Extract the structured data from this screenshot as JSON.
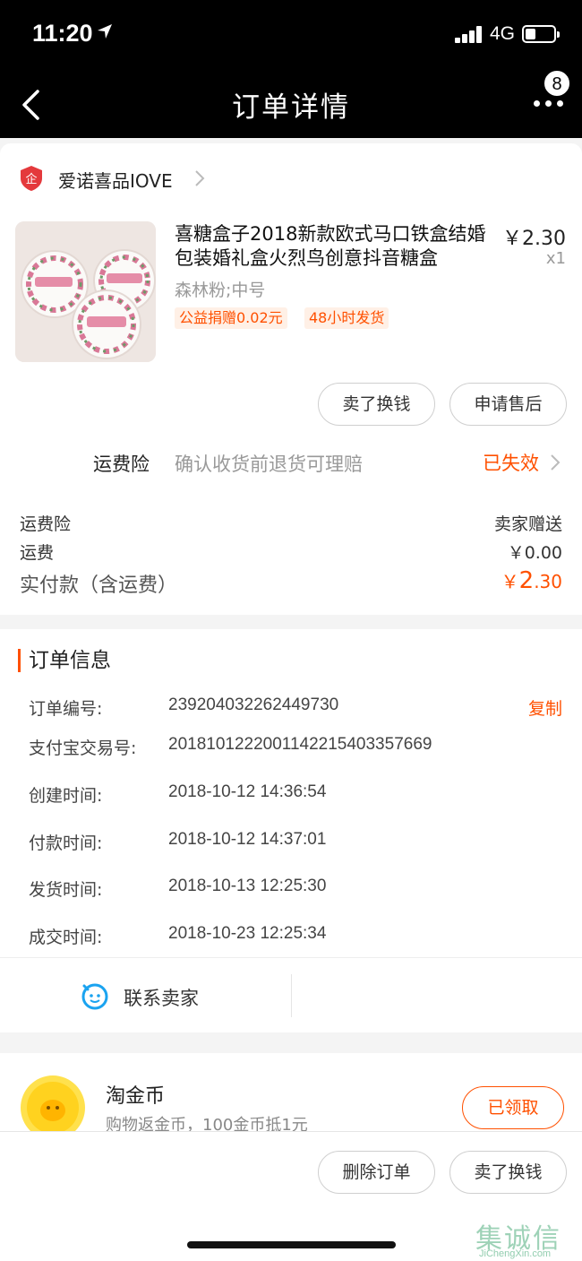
{
  "status_bar": {
    "time": "11:20",
    "network": "4G",
    "battery_level": 0.35
  },
  "nav": {
    "title": "订单详情",
    "badge_count": "8"
  },
  "shop": {
    "name": "爱诺喜品IOVE"
  },
  "product": {
    "title": "喜糖盒子2018新款欧式马口铁盒结婚包装婚礼盒火烈鸟创意抖音糖盒",
    "price": "￥2.30",
    "quantity": "x1",
    "sku": "森林粉;中号",
    "tags": [
      "公益捐赠0.02元",
      "48小时发货"
    ],
    "actions": [
      "卖了换钱",
      "申请售后"
    ]
  },
  "insurance": {
    "title": "运费险",
    "description": "确认收货前退货可理赔",
    "status": "已失效"
  },
  "summary": {
    "rows": [
      {
        "label": "运费险",
        "value": "卖家赠送"
      },
      {
        "label": "运费",
        "value": "￥0.00"
      }
    ],
    "total_label": "实付款（含运费）",
    "total_currency": "￥",
    "total_int": "2",
    "total_dec": ".30"
  },
  "order_info": {
    "heading": "订单信息",
    "copy_label": "复制",
    "rows": [
      {
        "label": "订单编号:",
        "value": "239204032262449730"
      },
      {
        "label": "支付宝交易号:",
        "value": "2018101222001142215403357669"
      },
      {
        "label": "创建时间:",
        "value": "2018-10-12 14:36:54"
      },
      {
        "label": "付款时间:",
        "value": "2018-10-12 14:37:01"
      },
      {
        "label": "发货时间:",
        "value": "2018-10-13 12:25:30"
      },
      {
        "label": "成交时间:",
        "value": "2018-10-23 12:25:34"
      }
    ],
    "contact_label": "联系卖家"
  },
  "coins": {
    "title": "淘金币",
    "description": "购物返金币，100金币抵1元",
    "button": "已领取"
  },
  "bottom_actions": [
    "删除订单",
    "卖了换钱"
  ],
  "watermark": {
    "text": "集诚信",
    "url_text": "JiChengXin.com"
  },
  "colors": {
    "accent": "#ff5000",
    "header": "#000000",
    "background": "#f4f4f4"
  }
}
